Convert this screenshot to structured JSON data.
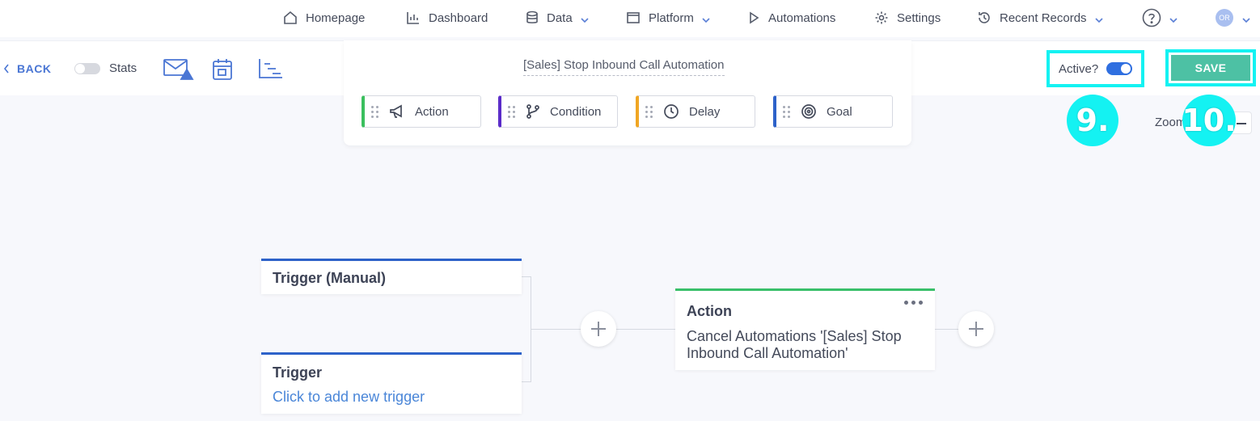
{
  "nav": {
    "homepage": "Homepage",
    "dashboard": "Dashboard",
    "data": "Data",
    "platform": "Platform",
    "automations": "Automations",
    "settings": "Settings",
    "recent_records": "Recent Records",
    "avatar_initials": "OR"
  },
  "toolbar": {
    "back": "BACK",
    "stats": "Stats"
  },
  "palette": {
    "title": "[Sales] Stop Inbound Call Automation",
    "blocks": [
      {
        "label": "Action",
        "color": "#3bbf5e",
        "icon": "megaphone-icon"
      },
      {
        "label": "Condition",
        "color": "#5b2cc9",
        "icon": "branch-icon"
      },
      {
        "label": "Delay",
        "color": "#f0a623",
        "icon": "clock-icon"
      },
      {
        "label": "Goal",
        "color": "#2d62c9",
        "icon": "target-icon"
      }
    ]
  },
  "controls": {
    "active_label": "Active?",
    "active_on": true,
    "save": "SAVE",
    "zoom": "Zoom"
  },
  "annotations": {
    "badge_9": "9.",
    "badge_10": "10."
  },
  "canvas": {
    "trigger_manual": {
      "title": "Trigger (Manual)"
    },
    "trigger_new": {
      "title": "Trigger",
      "link": "Click to add new trigger"
    },
    "action": {
      "title": "Action",
      "text": "Cancel Automations '[Sales] Stop Inbound Call Automation'"
    }
  },
  "colors": {
    "accent": "#4a76d4",
    "save_green": "#4dc1a4",
    "highlight_cyan": "#14f2f2"
  }
}
